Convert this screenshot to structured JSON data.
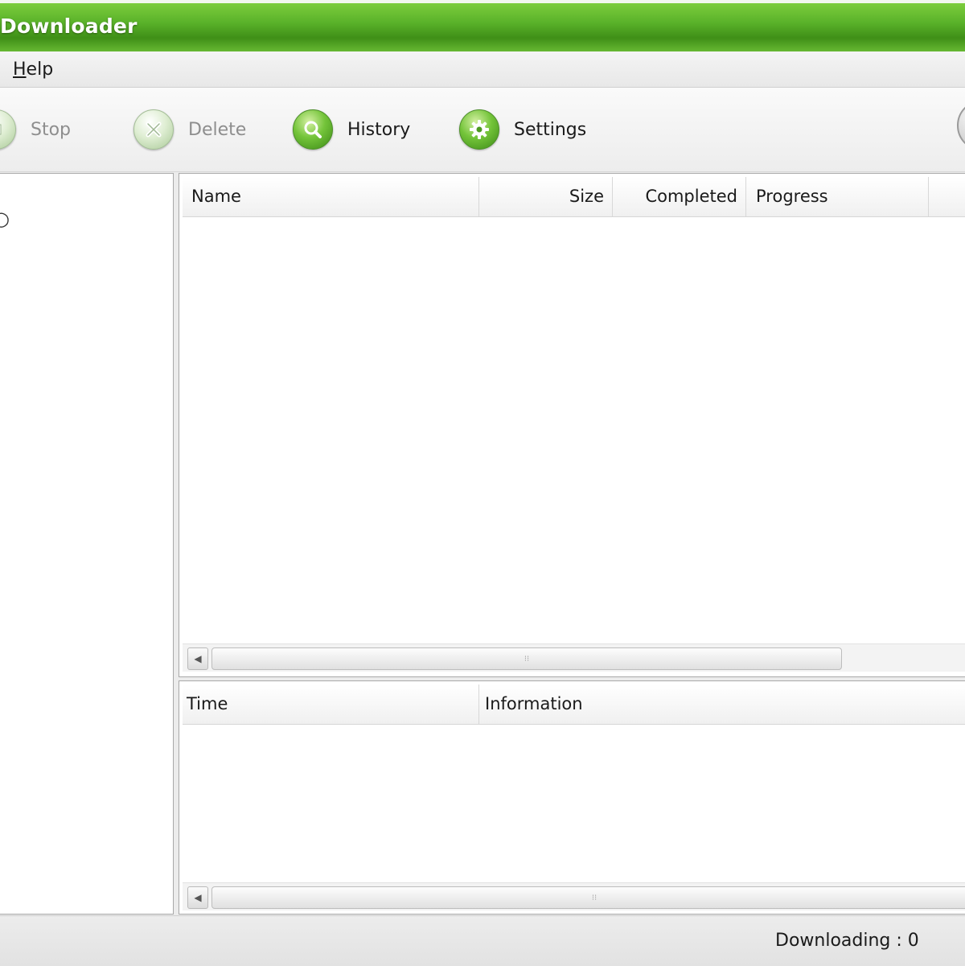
{
  "window": {
    "title": "Downloader"
  },
  "menu": {
    "items": [
      {
        "label_hotkey": "H",
        "label_rest": "elp"
      }
    ]
  },
  "toolbar": {
    "buttons": [
      {
        "label": "Stop",
        "icon": "stop-icon",
        "enabled": false
      },
      {
        "label": "Delete",
        "icon": "delete-icon",
        "enabled": false
      },
      {
        "label": "History",
        "icon": "history-magnifier-icon",
        "enabled": true
      },
      {
        "label": "Settings",
        "icon": "settings-gear-icon",
        "enabled": true
      }
    ]
  },
  "downloads": {
    "columns": [
      "Name",
      "Size",
      "Completed",
      "Progress"
    ],
    "rows": []
  },
  "log": {
    "columns": [
      "Time",
      "Information"
    ],
    "rows": []
  },
  "status": {
    "text": "Downloading : 0"
  },
  "colors": {
    "accent": "#5ab22a",
    "title_text": "#ffffff"
  }
}
